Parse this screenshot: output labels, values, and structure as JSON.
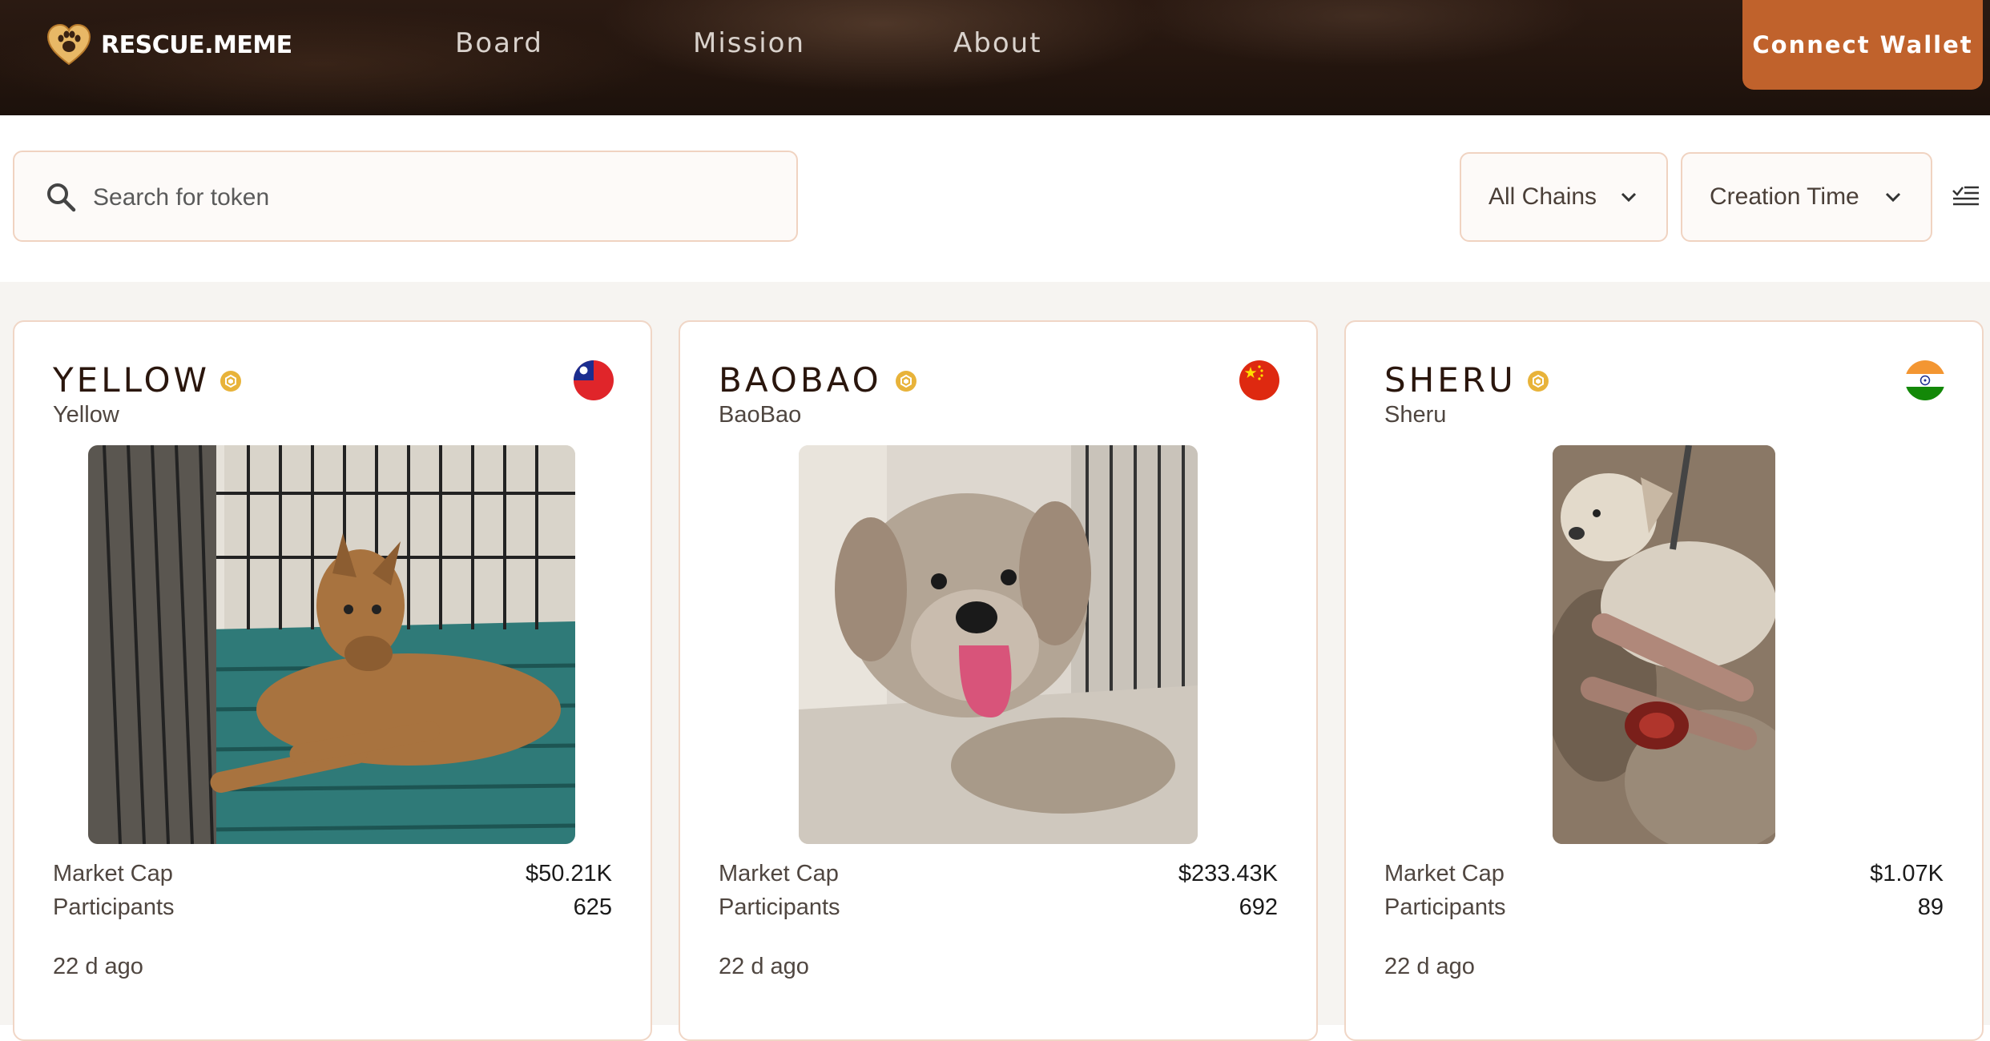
{
  "header": {
    "logo_text": "RESCUE.MEME",
    "nav": [
      "Board",
      "Mission",
      "About"
    ],
    "connect_label": "Connect Wallet"
  },
  "filters": {
    "search_placeholder": "Search for token",
    "chain_filter": "All Chains",
    "sort_by": "Creation Time"
  },
  "labels": {
    "market_cap": "Market Cap",
    "participants": "Participants"
  },
  "tokens": [
    {
      "symbol": "YELLOW",
      "name": "Yellow",
      "market_cap": "$50.21K",
      "participants": "625",
      "age": "22 d ago",
      "flag": "taiwan-flag-icon"
    },
    {
      "symbol": "BAOBAO",
      "name": "BaoBao",
      "market_cap": "$233.43K",
      "participants": "692",
      "age": "22 d ago",
      "flag": "china-flag-icon"
    },
    {
      "symbol": "SHERU",
      "name": "Sheru",
      "market_cap": "$1.07K",
      "participants": "89",
      "age": "22 d ago",
      "flag": "india-flag-icon"
    }
  ],
  "colors": {
    "accent": "#c0622c",
    "header_bg": "#23150e",
    "card_border": "#f0d6c6",
    "verified_badge": "#e8b33a"
  }
}
